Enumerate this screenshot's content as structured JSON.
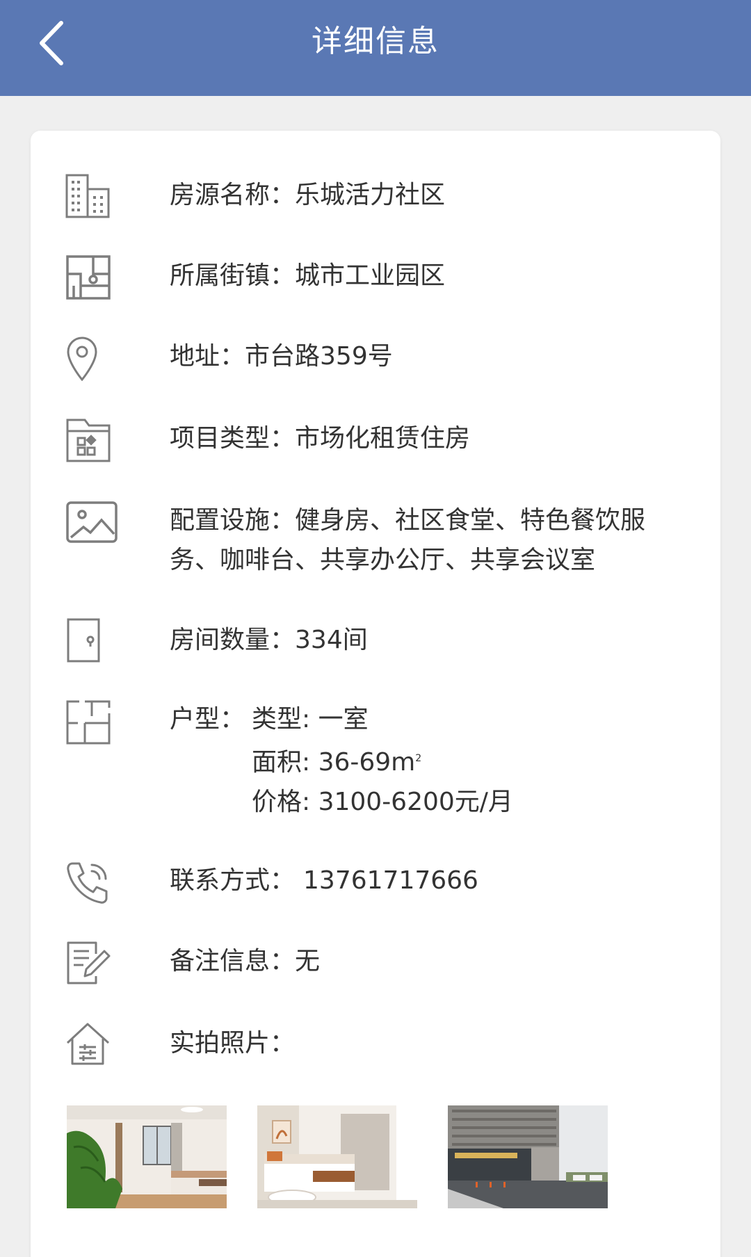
{
  "header": {
    "title": "详细信息",
    "back_icon": "chevron-left-icon",
    "background_color": "#5a78b4"
  },
  "details": {
    "name": {
      "label": "房源名称：",
      "value": "乐城活力社区",
      "icon": "building-icon"
    },
    "street": {
      "label": "所属街镇：",
      "value": "城市工业园区",
      "icon": "district-map-icon"
    },
    "address": {
      "label": "地址：",
      "value": "市台路359号",
      "icon": "location-pin-icon"
    },
    "project_type": {
      "label": "项目类型：",
      "value": "市场化租赁住房",
      "icon": "folder-grid-icon"
    },
    "facilities": {
      "label": "配置设施：",
      "line1": "健身房、社区食堂、特色餐饮服",
      "line2": "务、咖啡台、共享办公厅、共享会议室",
      "icon": "image-icon"
    },
    "rooms": {
      "label": "房间数量：",
      "value": "334间",
      "icon": "door-icon"
    },
    "layout": {
      "label": "户型：",
      "type_line": "类型: 一室",
      "area_line": "面积: 36-69m",
      "price_line": "价格: 3100-6200元/月",
      "icon": "floorplan-icon"
    },
    "contact": {
      "label": "联系方式：",
      "value": "13761717666",
      "icon": "phone-icon"
    },
    "notes": {
      "label": "备注信息：",
      "value": "无",
      "icon": "edit-note-icon"
    },
    "photos": {
      "label": "实拍照片：",
      "icon": "house-settings-icon"
    }
  },
  "photos": [
    {
      "name": "bedroom-photo-1"
    },
    {
      "name": "bedroom-photo-2"
    },
    {
      "name": "building-exterior-photo"
    }
  ],
  "colors": {
    "text": "#333333",
    "icon": "#7d7d7d",
    "page_bg": "#efefef"
  }
}
